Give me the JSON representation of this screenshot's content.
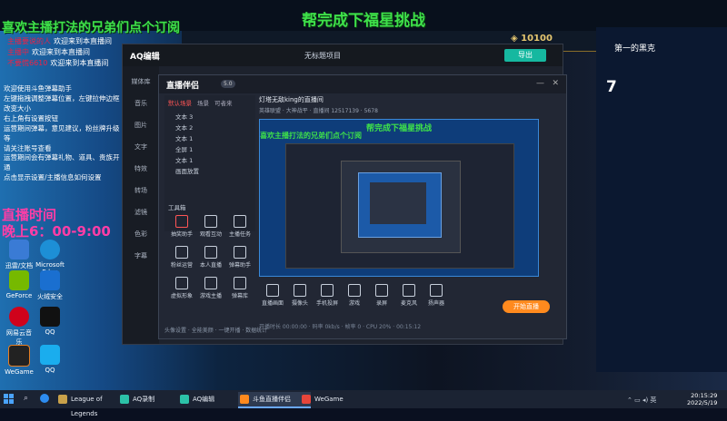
{
  "stream": {
    "title": "帮完成下福星挑战",
    "subtitle": "喜欢主播打法的兄弟们点个订阅",
    "hours_label": "直播时间",
    "hours_value": "晚上6：00-9:00"
  },
  "chat": [
    {
      "user": "主播要说的人",
      "msg": "欢迎来到本直播间"
    },
    {
      "user": "主播中",
      "msg": "欢迎来到本直播间"
    },
    {
      "user": "不要慌6610",
      "msg": "欢迎来到本直播间"
    }
  ],
  "notice_lines": [
    "欢迎使用斗鱼弹幕助手",
    "左键拖拽调整弹幕位置，左键拉伸边框改变大小",
    "右上角有设置按钮",
    "运营期间弹幕，意见建议，粉丝牌升级等",
    "请关注账号查看"
  ],
  "notice2_lines": [
    "运营期间会有弹幕礼物、道具、贵族开通",
    "点击显示设置/主播信息如何设置"
  ],
  "lol": {
    "coins": "10100",
    "rank": "第一的黑克",
    "number": "7"
  },
  "desktop_icons": [
    {
      "label": "迅雷/文档",
      "color": "#3a7bd5"
    },
    {
      "label": "Microsoft Edge",
      "color": "#1d8fd6"
    },
    {
      "label": "GeForce",
      "color": "#76b900"
    },
    {
      "label": "火绒安全",
      "color": "#e64a19"
    },
    {
      "label": "网易云音乐",
      "color": "#d0021b"
    },
    {
      "label": "QQ",
      "color": "#1aadee"
    },
    {
      "label": "WeGame",
      "color": "#e67e22"
    },
    {
      "label": "QQ",
      "color": "#1aadee"
    }
  ],
  "aq": {
    "logo": "AQ编辑",
    "center": "无标题项目",
    "export": "导出",
    "side_items": [
      "媒体库",
      "音乐",
      "图片",
      "文字",
      "特效",
      "转场",
      "滤镜",
      "色彩",
      "字幕"
    ]
  },
  "zb": {
    "logo": "直播伴侣",
    "badge": "5.0",
    "tabs": [
      "默认场景",
      "场景",
      "可者来"
    ],
    "scenes": [
      "文本 3",
      "文本 2",
      "文本 1",
      "全屏 1",
      "文本 1",
      "画面放置"
    ],
    "tools_label": "工具箱",
    "tools": [
      "抽奖助手",
      "观看互动",
      "主播任务",
      "粉丝运营",
      "本人直播",
      "弹幕助手",
      "虚拟形象",
      "游戏主播",
      "弹幕库",
      "礼物特效",
      "录屏",
      "更多"
    ],
    "room_name": "灯塔无敌king的直播间",
    "room_meta": "英雄联盟 · 大神战平 · 直播间 12517139 · 5678",
    "bottom": [
      "直播画面",
      "摄像头",
      "手机投屏",
      "游戏",
      "录屏",
      "麦克风",
      "扬声器"
    ],
    "start_button": "开始直播",
    "status": "开播时长 00:00:00 · 码率 0kb/s · 帧率 0 · CPU 20% · 00:15:12",
    "tip": "头像设置 · 全能美颜 · 一键开播 · 数据统计"
  },
  "taskbar": {
    "items": [
      {
        "label": "League of Legends",
        "color": "#c8a14a",
        "active": false
      },
      {
        "label": "AQ录制",
        "color": "#2cc2a8",
        "active": false
      },
      {
        "label": "AQ编辑",
        "color": "#2cc2a8",
        "active": false
      },
      {
        "label": "斗鱼直播伴侣",
        "color": "#ff8a1e",
        "active": true
      },
      {
        "label": "WeGame",
        "color": "#e6453a",
        "active": false
      }
    ],
    "time": "20:15:29",
    "date": "2022/5/19"
  }
}
